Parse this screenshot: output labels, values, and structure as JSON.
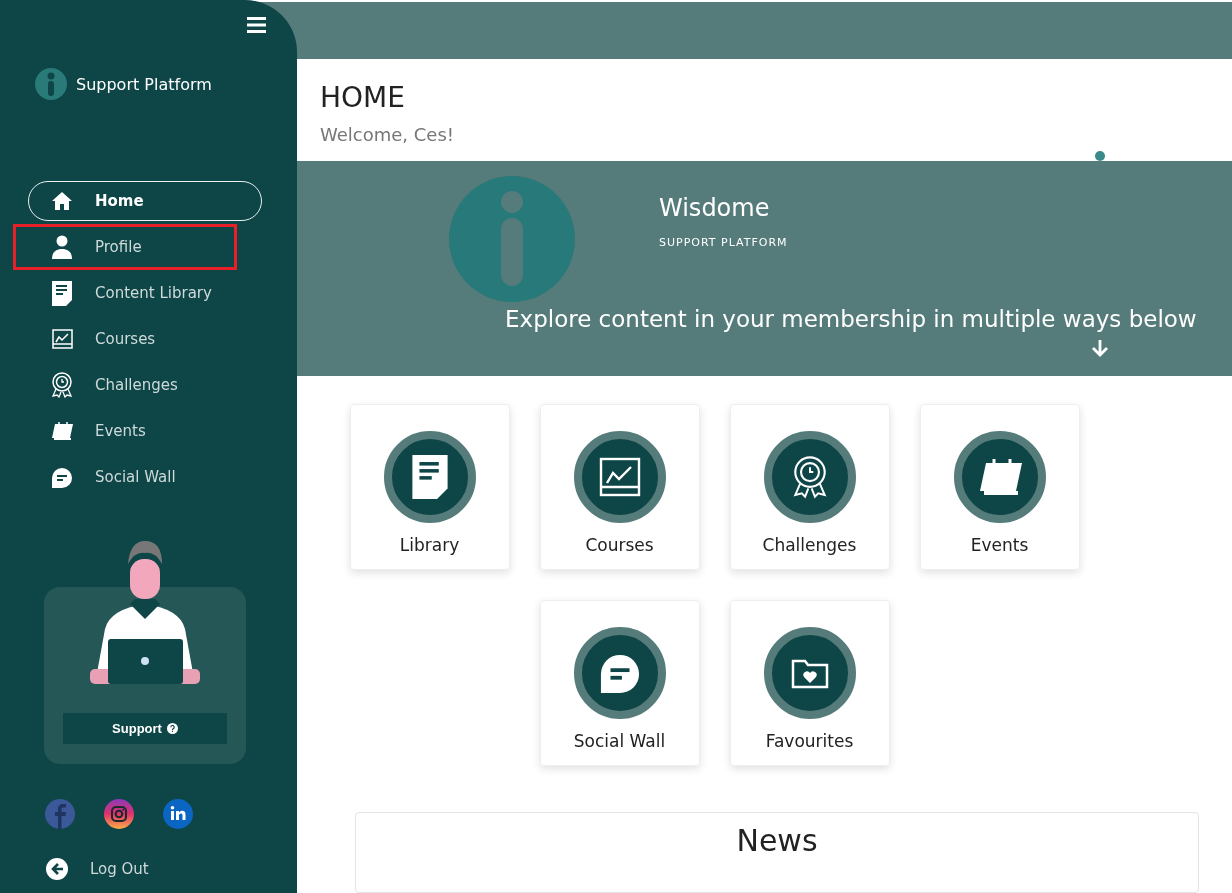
{
  "sidebar": {
    "brand": "Support Platform",
    "items": [
      {
        "label": "Home",
        "kind": "home",
        "selected": true,
        "highlighted": false
      },
      {
        "label": "Profile",
        "kind": "person",
        "selected": false,
        "highlighted": true
      },
      {
        "label": "Content Library",
        "kind": "document",
        "selected": false,
        "highlighted": false
      },
      {
        "label": "Courses",
        "kind": "board",
        "selected": false,
        "highlighted": false
      },
      {
        "label": "Challenges",
        "kind": "award",
        "selected": false,
        "highlighted": false
      },
      {
        "label": "Events",
        "kind": "calendar",
        "selected": false,
        "highlighted": false
      },
      {
        "label": "Social Wall",
        "kind": "chat",
        "selected": false,
        "highlighted": false
      }
    ],
    "support_button": "Support",
    "logout": "Log Out"
  },
  "header": {
    "title": "HOME",
    "subtitle": "Welcome, Ces!"
  },
  "banner": {
    "title": "Wisdome",
    "subtitle": "SUPPORT PLATFORM",
    "tagline": "Explore content in your membership in multiple ways below"
  },
  "tiles": [
    {
      "label": "Library",
      "kind": "document"
    },
    {
      "label": "Courses",
      "kind": "board"
    },
    {
      "label": "Challenges",
      "kind": "award"
    },
    {
      "label": "Events",
      "kind": "calendar"
    },
    {
      "label": "Social Wall",
      "kind": "chat"
    },
    {
      "label": "Favourites",
      "kind": "folder"
    }
  ],
  "news": {
    "title": "News"
  }
}
